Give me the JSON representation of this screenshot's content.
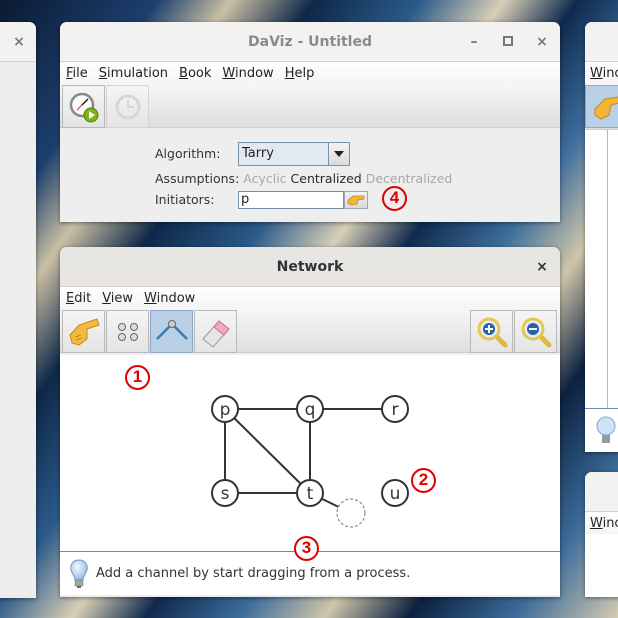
{
  "main_window": {
    "title": "DaViz - Untitled",
    "controls": {
      "minimize": "–",
      "maximize": "□",
      "close": "×"
    },
    "menu": [
      "File",
      "Simulation",
      "Book",
      "Window",
      "Help"
    ],
    "toolbar": [
      {
        "name": "start-simulation",
        "icon": "clock-play-icon",
        "enabled": true
      },
      {
        "name": "reset-simulation",
        "icon": "clock-reset-icon",
        "enabled": false
      }
    ],
    "form": {
      "algorithm_label": "Algorithm:",
      "algorithm_value": "Tarry",
      "assumptions_label": "Assumptions:",
      "assumptions": [
        {
          "label": "Acyclic",
          "active": false
        },
        {
          "label": "Centralized",
          "active": true
        },
        {
          "label": "Decentralized",
          "active": false
        }
      ],
      "initiators_label": "Initiators:",
      "initiators_value": "p"
    }
  },
  "network_window": {
    "title": "Network",
    "close": "×",
    "menu": [
      "Edit",
      "View",
      "Window"
    ],
    "tools": [
      {
        "name": "select-tool",
        "icon": "pointing-hand-icon",
        "selected": false
      },
      {
        "name": "add-process-tool",
        "icon": "processes-icon",
        "selected": false
      },
      {
        "name": "add-channel-tool",
        "icon": "channel-icon",
        "selected": true
      },
      {
        "name": "eraser-tool",
        "icon": "eraser-icon",
        "selected": false
      }
    ],
    "zoom_tools": [
      {
        "name": "zoom-in",
        "icon": "zoom-in-icon"
      },
      {
        "name": "zoom-out",
        "icon": "zoom-out-icon"
      }
    ],
    "graph": {
      "nodes": [
        "p",
        "q",
        "r",
        "s",
        "t",
        "u"
      ],
      "edges": [
        [
          "p",
          "q"
        ],
        [
          "q",
          "r"
        ],
        [
          "p",
          "s"
        ],
        [
          "p",
          "t"
        ],
        [
          "q",
          "t"
        ],
        [
          "s",
          "t"
        ]
      ],
      "pending_channel_from": "t"
    },
    "status_message": "Add a channel by start dragging from a process."
  },
  "right_window": {
    "menu_partial": "Winc"
  },
  "right_window_lower": {
    "menu_partial": "Winc"
  },
  "left_window": {
    "close": "×"
  },
  "annotations": [
    "1",
    "2",
    "3",
    "4"
  ],
  "colors": {
    "annotation_red": "#e00000",
    "selected_tool": "#b8cfe6",
    "status_border": "#6d87b8"
  }
}
